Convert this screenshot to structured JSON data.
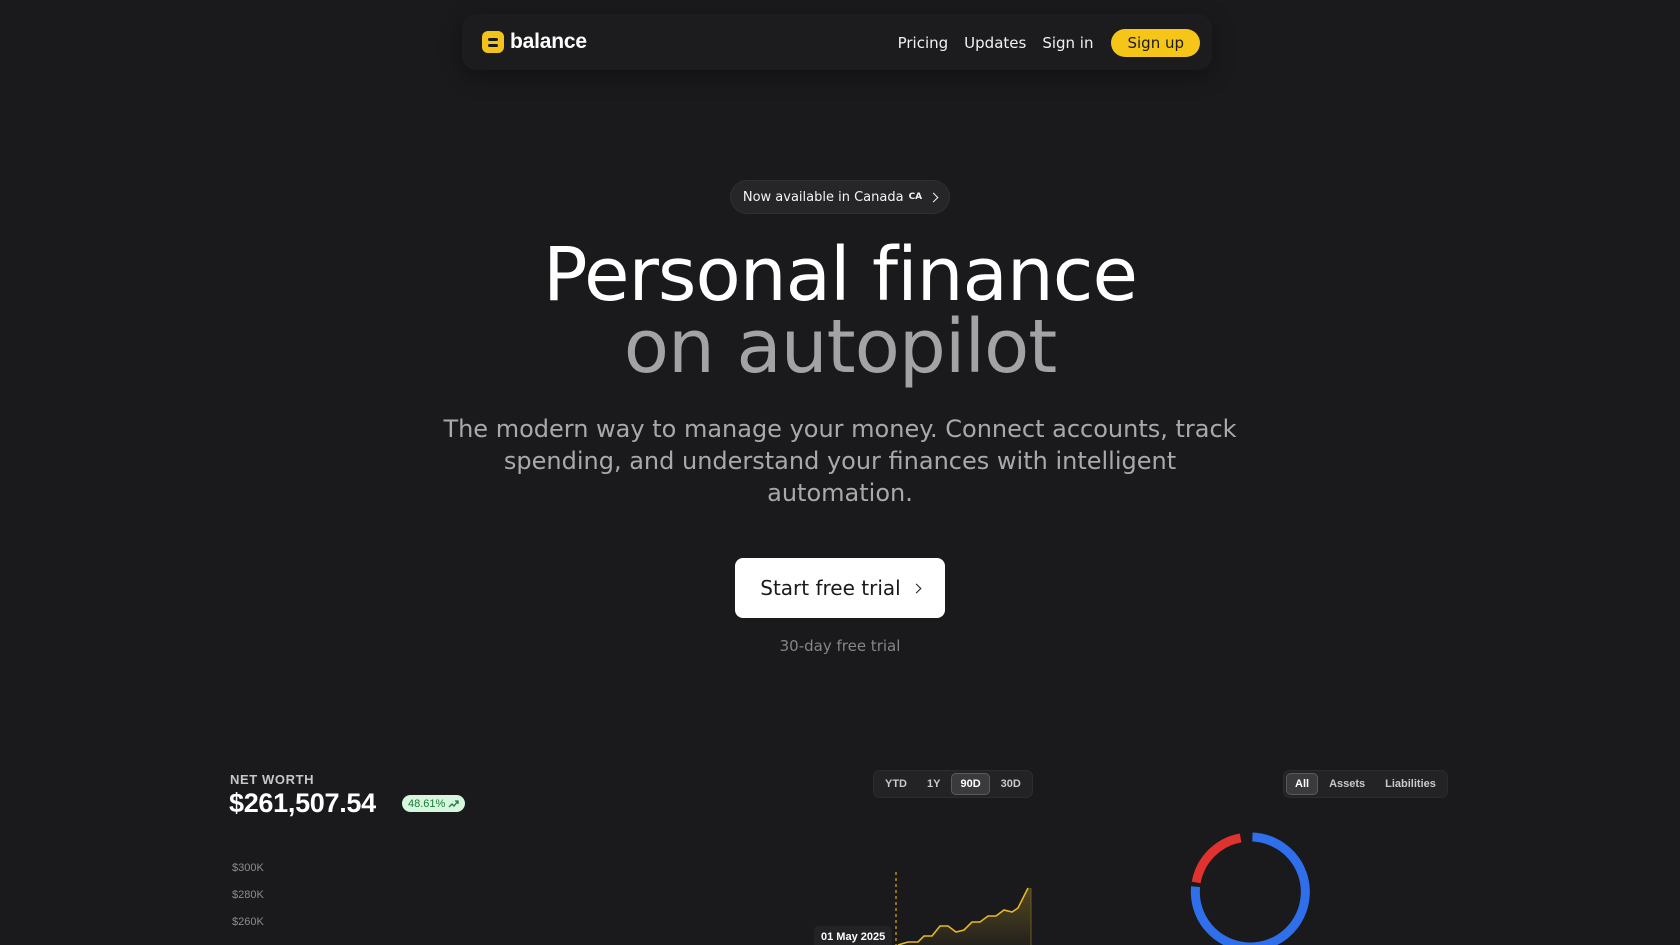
{
  "nav": {
    "logo_text": "balance",
    "links": [
      "Pricing",
      "Updates",
      "Sign in"
    ],
    "signup_label": "Sign up"
  },
  "hero": {
    "announcement": "Now available in Canada",
    "announcement_flag": "CA",
    "headline_line1": "Personal finance",
    "headline_line2": "on autopilot",
    "subheadline": "The modern way to manage your money. Connect accounts, track spending, and understand your finances with intelligent automation.",
    "cta_label": "Start free trial",
    "cta_note": "30-day free trial"
  },
  "dashboard": {
    "net_worth_label": "NET WORTH",
    "net_worth_value": "$261,507.54",
    "change_badge": "48.61%",
    "range_tabs": [
      "YTD",
      "1Y",
      "90D",
      "30D"
    ],
    "range_active": "90D",
    "filter_tabs": [
      "All",
      "Assets",
      "Liabilities"
    ],
    "filter_active": "All",
    "y_ticks": [
      "$300K",
      "$280K",
      "$260K"
    ],
    "tooltip_date": "01 May 2025",
    "colors": {
      "accent": "#f5c518",
      "line": "#e5b82a",
      "assets": "#2f6fec",
      "liabilities": "#e0332f",
      "positive_bg": "#d7f6de",
      "positive_fg": "#1a7a3a"
    }
  }
}
